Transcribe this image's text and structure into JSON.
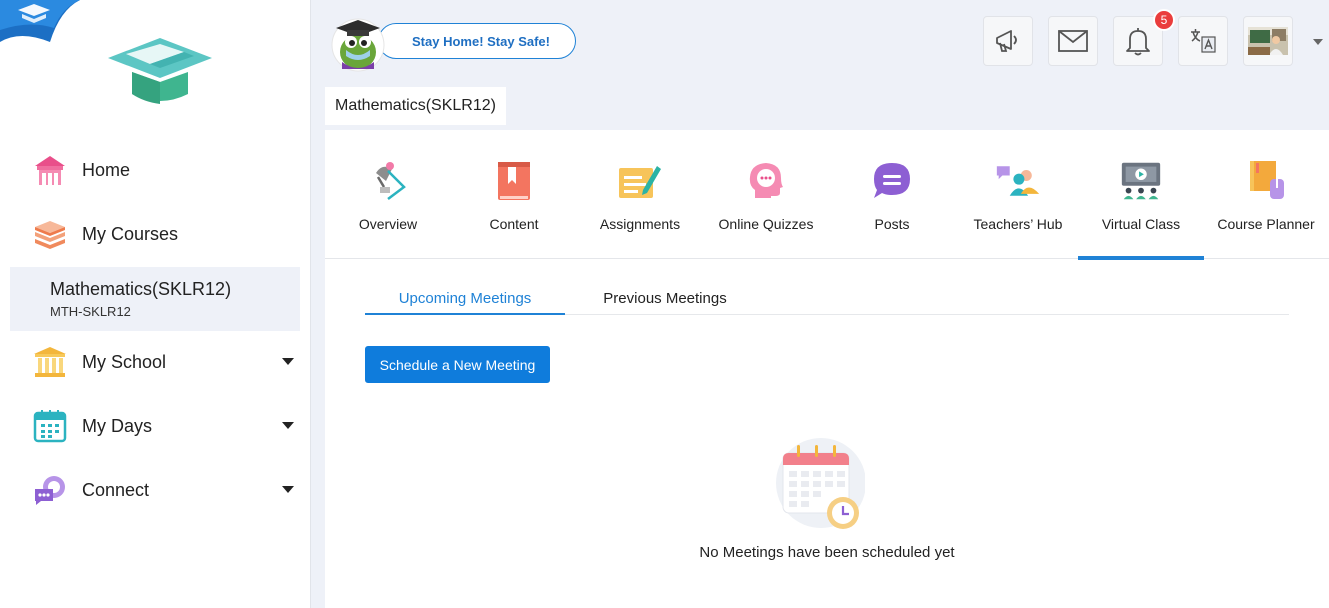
{
  "sidebar": {
    "items": [
      {
        "label": "Home"
      },
      {
        "label": "My Courses"
      },
      {
        "label": "My School"
      },
      {
        "label": "My Days"
      },
      {
        "label": "Connect"
      }
    ],
    "active_course": {
      "name": "Mathematics(SKLR12)",
      "code": "MTH-SKLR12"
    }
  },
  "topbar": {
    "banner_text": "Stay Home! Stay Safe!",
    "notification_count": "5"
  },
  "course_tab": {
    "label": "Mathematics(SKLR12)"
  },
  "nav_tabs": [
    {
      "label": "Overview"
    },
    {
      "label": "Content"
    },
    {
      "label": "Assignments"
    },
    {
      "label": "Online Quizzes"
    },
    {
      "label": "Posts"
    },
    {
      "label": "Teachers’ Hub"
    },
    {
      "label": "Virtual Class"
    },
    {
      "label": "Course Planner"
    }
  ],
  "active_tab": "Virtual Class",
  "meetings": {
    "tabs": [
      {
        "label": "Upcoming Meetings"
      },
      {
        "label": "Previous Meetings"
      }
    ],
    "schedule_button": "Schedule a New Meeting",
    "empty_message": "No Meetings have been scheduled yet"
  },
  "colors": {
    "accent": "#1f82d6",
    "button": "#0f7cdc",
    "badge": "#ea3d3d"
  }
}
